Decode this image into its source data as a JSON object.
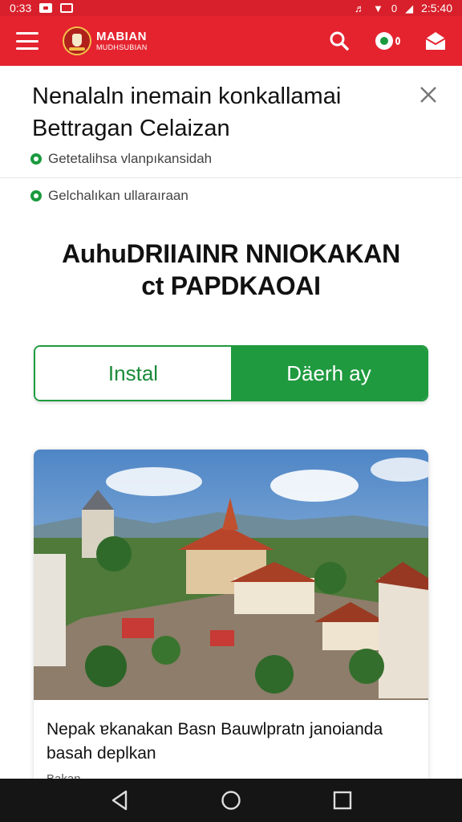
{
  "status_bar": {
    "time_left": "0:33",
    "time_right": "2:5:40",
    "battery_label": "0"
  },
  "app_bar": {
    "brand_title": "MABIAN",
    "brand_subtitle": "MUDHSUBIAN",
    "icons": {
      "menu": "menu-icon",
      "search": "search-icon",
      "notifications": "notification-icon",
      "mail": "mail-icon"
    }
  },
  "notice": {
    "title": "Nenalaln inemain konkallamai Bettragan Celaizan",
    "bullets": [
      "Getetalihsa vlanpıkansidah",
      "Gelchalıkan ullaraıraan"
    ]
  },
  "headline": {
    "line1": "AuhuDRIIAINR NNIOKAKAN",
    "line2": "ct PAPDKAOAI"
  },
  "segment": {
    "install_label": "Instal",
    "other_label": "Däerh ay"
  },
  "article": {
    "text": "Nepak ɐkanakan Basn Bauwlpratn janoianda basah deplkan",
    "meta": "Bakan ..."
  },
  "colors": {
    "primary_red": "#e4232f",
    "status_red": "#d7202b",
    "accent_green": "#1f9a3f",
    "nav_bar": "#151515"
  }
}
